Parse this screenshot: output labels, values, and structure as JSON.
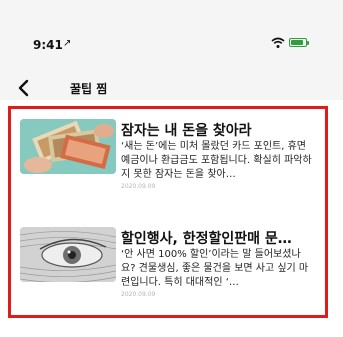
{
  "status_bar": {
    "time": "9:41",
    "location_glyph": "↗"
  },
  "header": {
    "title": "꿀팁 찜"
  },
  "cards": [
    {
      "title": "잠자는 내 돈을 찾아라",
      "body": "‘새는 돈’에는 미처 몰랐던 카드 포인트, 휴면예금이나 환급금도 포함됩니다. 확실히 파악하지 못한 잠자는 돈을 찾아…",
      "date": "2020.09.09"
    },
    {
      "title": "할인행사, 한정할인판매 문…",
      "body": "‘안 사면 100% 할인’이라는 말 들어보셨나요? 견물생심, 좋은 물건을 보면 사고 싶기 마련입니다. 특히 대대적인 ‘…",
      "date": "2020.09.09"
    }
  ],
  "colors": {
    "highlight": "#e01b1b",
    "battery": "#2e9e3e"
  }
}
